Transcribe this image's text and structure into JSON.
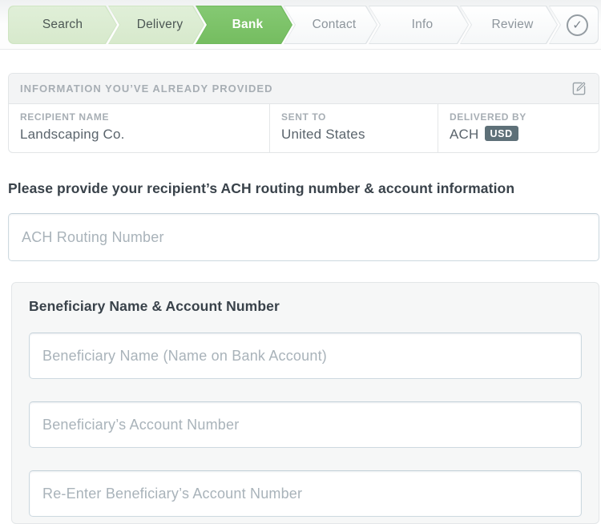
{
  "colors": {
    "active_step_green": "#7bc268",
    "done_step_green": "#dcedd3",
    "badge_bg": "#5e7078"
  },
  "wizard": {
    "steps": [
      {
        "label": "Search",
        "state": "done"
      },
      {
        "label": "Delivery",
        "state": "done"
      },
      {
        "label": "Bank",
        "state": "active"
      },
      {
        "label": "Contact",
        "state": "todo"
      },
      {
        "label": "Info",
        "state": "todo"
      },
      {
        "label": "Review",
        "state": "todo"
      },
      {
        "label": "",
        "state": "todo",
        "icon": "check-circle"
      }
    ]
  },
  "summary": {
    "title": "INFORMATION YOU’VE ALREADY PROVIDED",
    "edit_icon": "edit-compose",
    "fields": [
      {
        "label": "RECIPIENT NAME",
        "value": "Landscaping Co."
      },
      {
        "label": "SENT TO",
        "value": "United States"
      },
      {
        "label": "DELIVERED BY",
        "value": "ACH",
        "badge": "USD"
      }
    ]
  },
  "form": {
    "prompt": "Please provide your recipient’s ACH routing number & account information",
    "ach_routing_placeholder": "ACH Routing Number",
    "beneficiary": {
      "heading": "Beneficiary Name & Account Number",
      "name_placeholder": "Beneficiary Name (Name on Bank Account)",
      "account_placeholder": "Beneficiary’s Account Number",
      "reenter_placeholder": "Re-Enter Beneficiary’s Account Number"
    }
  },
  "icons": {
    "check": "✓"
  }
}
